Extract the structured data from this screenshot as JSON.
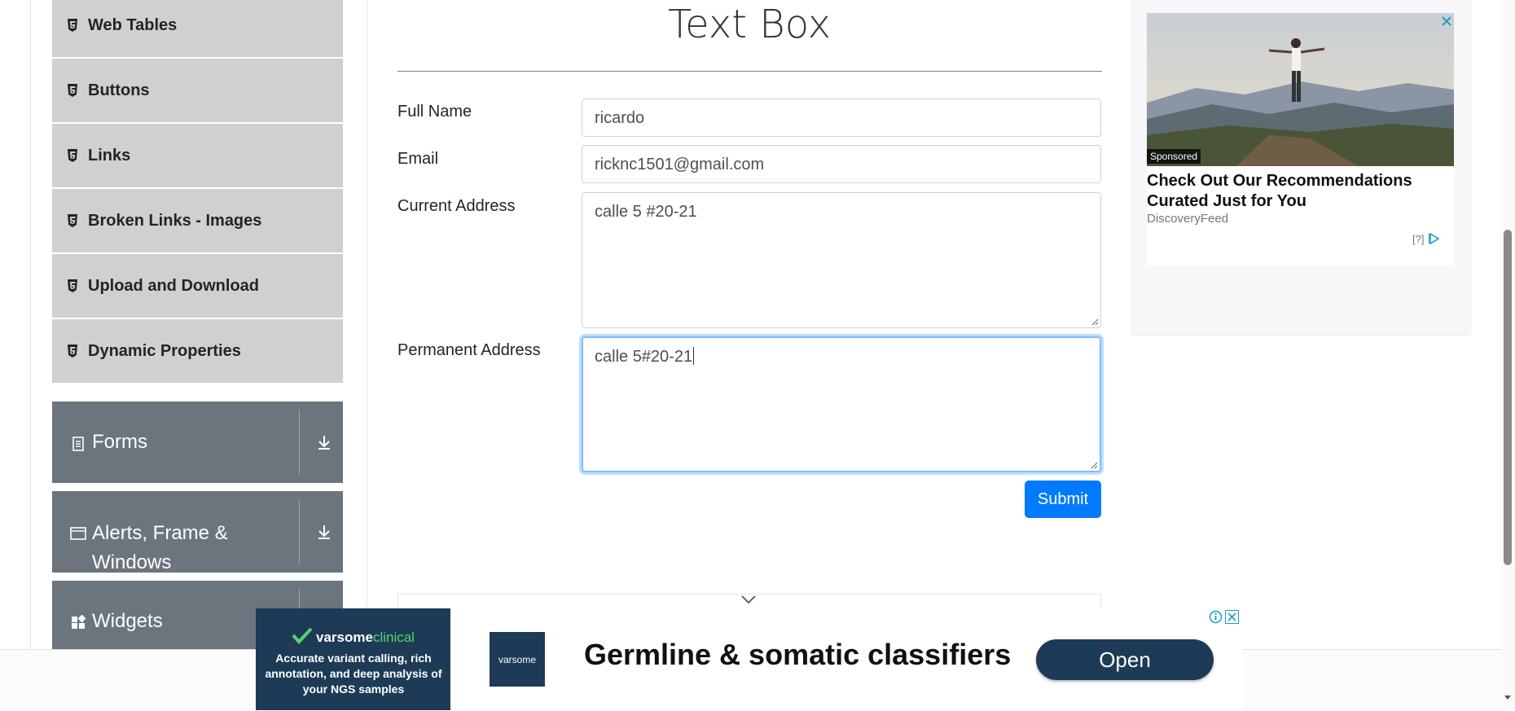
{
  "sidebar": {
    "items": [
      {
        "label": "Web Tables"
      },
      {
        "label": "Buttons"
      },
      {
        "label": "Links"
      },
      {
        "label": "Broken Links - Images"
      },
      {
        "label": "Upload and Download"
      },
      {
        "label": "Dynamic Properties"
      }
    ],
    "groups": [
      {
        "label": "Forms",
        "icon": "document-icon"
      },
      {
        "label_line1": "Alerts, Frame &",
        "label_line2": "Windows",
        "icon": "window-icon"
      },
      {
        "label": "Widgets",
        "icon": "widgets-icon"
      }
    ]
  },
  "main": {
    "title": "Text Box",
    "full_name": {
      "label": "Full Name",
      "value": "ricardo"
    },
    "email": {
      "label": "Email",
      "value": "ricknc1501@gmail.com"
    },
    "current_address": {
      "label": "Current Address",
      "value": "calle 5 #20-21"
    },
    "permanent_address": {
      "label": "Permanent Address",
      "value": "calle 5#20-21"
    },
    "submit_label": "Submit"
  },
  "ad_top": {
    "sponsored": "Sponsored",
    "headline": "Check Out Our Recommendations Curated Just for You",
    "source": "DiscoveryFeed",
    "help": "[?]"
  },
  "ad_bottom": {
    "brand_main": "varsome",
    "brand_sub": "clinical",
    "description": "Accurate variant calling, rich annotation, and deep analysis of your NGS samples",
    "logo_text": "varsome",
    "headline": "Germline & somatic classifiers",
    "cta": "Open"
  },
  "colors": {
    "accent": "#007bff",
    "sidebar_item": "#d0d0d0",
    "sidebar_group": "#6c757d",
    "ad_navy": "#1d3b57"
  }
}
